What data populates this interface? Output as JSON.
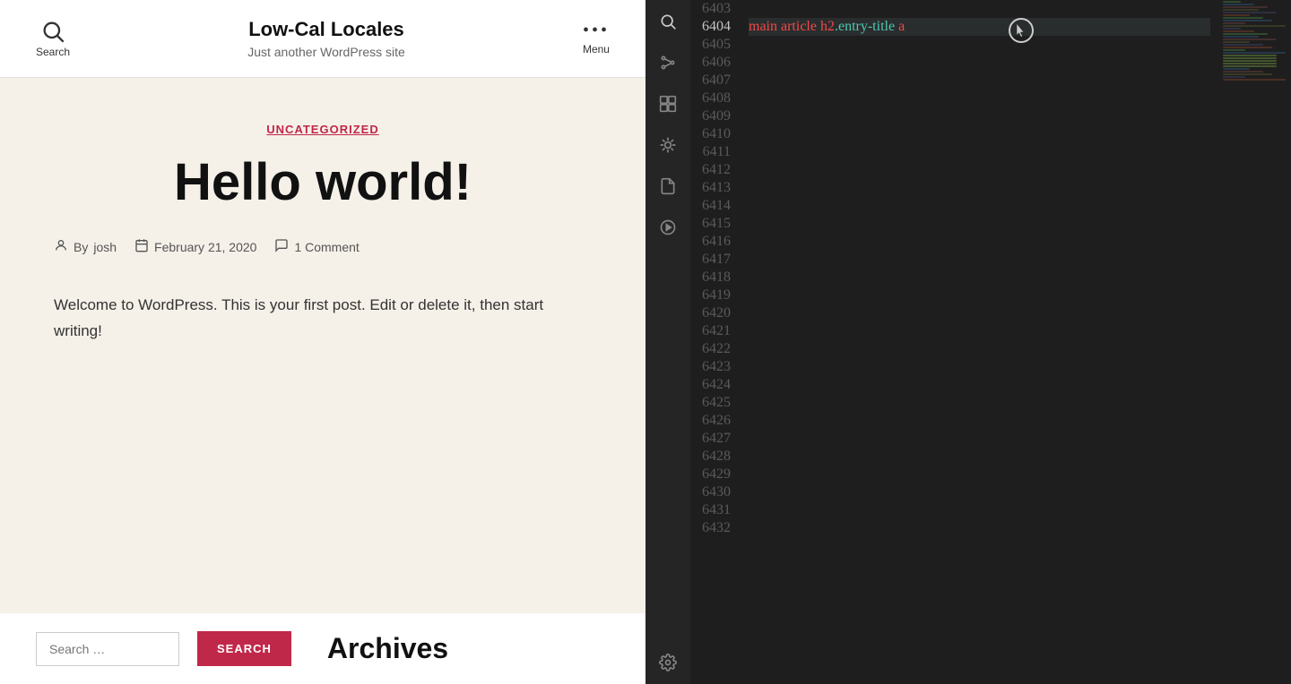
{
  "blog": {
    "header": {
      "search_label": "Search",
      "title": "Low-Cal Locales",
      "subtitle": "Just another WordPress site",
      "menu_label": "Menu"
    },
    "post": {
      "category": "UNCATEGORIZED",
      "title": "Hello world!",
      "author_prefix": "By",
      "author": "josh",
      "date": "February 21, 2020",
      "comments": "1 Comment",
      "body": "Welcome to WordPress. This is your first post. Edit or delete it, then start writing!"
    },
    "footer": {
      "search_placeholder": "Search …",
      "search_button": "SEARCH",
      "archives_title": "Archives"
    }
  },
  "editor": {
    "highlighted_line": {
      "number": 6404,
      "content": "main article h2.entry-title a"
    },
    "line_start": 6403,
    "lines": [
      {
        "num": 6403,
        "content": ""
      },
      {
        "num": 6404,
        "content": "main article h2.entry-title a",
        "highlighted": true
      },
      {
        "num": 6405,
        "content": ""
      },
      {
        "num": 6406,
        "content": ""
      },
      {
        "num": 6407,
        "content": ""
      },
      {
        "num": 6408,
        "content": ""
      },
      {
        "num": 6409,
        "content": ""
      },
      {
        "num": 6410,
        "content": ""
      },
      {
        "num": 6411,
        "content": ""
      },
      {
        "num": 6412,
        "content": ""
      },
      {
        "num": 6413,
        "content": ""
      },
      {
        "num": 6414,
        "content": ""
      },
      {
        "num": 6415,
        "content": ""
      },
      {
        "num": 6416,
        "content": ""
      },
      {
        "num": 6417,
        "content": ""
      },
      {
        "num": 6418,
        "content": ""
      },
      {
        "num": 6419,
        "content": ""
      },
      {
        "num": 6420,
        "content": ""
      },
      {
        "num": 6421,
        "content": ""
      },
      {
        "num": 6422,
        "content": ""
      },
      {
        "num": 6423,
        "content": ""
      },
      {
        "num": 6424,
        "content": ""
      },
      {
        "num": 6425,
        "content": ""
      },
      {
        "num": 6426,
        "content": ""
      },
      {
        "num": 6427,
        "content": ""
      },
      {
        "num": 6428,
        "content": ""
      },
      {
        "num": 6429,
        "content": ""
      },
      {
        "num": 6430,
        "content": ""
      },
      {
        "num": 6431,
        "content": ""
      },
      {
        "num": 6432,
        "content": ""
      }
    ]
  }
}
